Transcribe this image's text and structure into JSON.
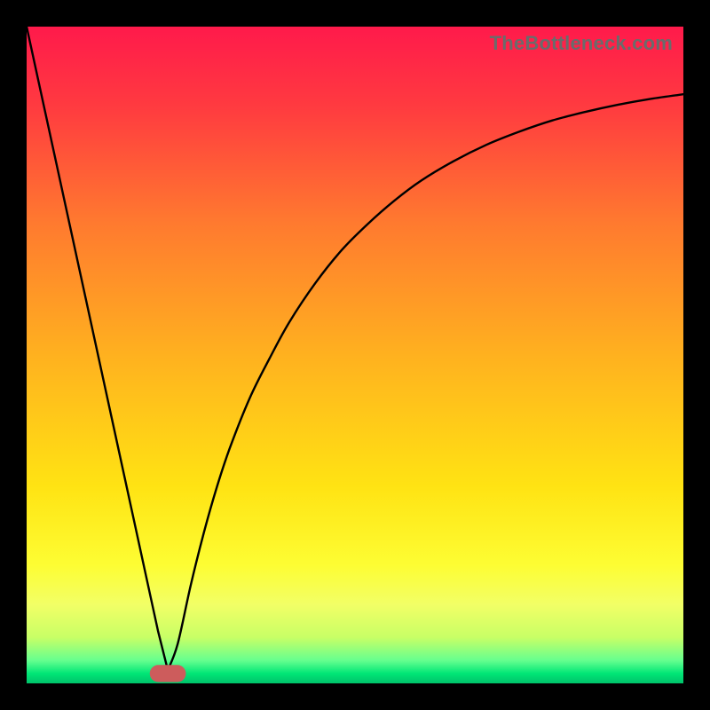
{
  "watermark": "TheBottleneck.com",
  "chart_data": {
    "type": "line",
    "title": "",
    "xlabel": "",
    "ylabel": "",
    "xlim": [
      0,
      100
    ],
    "ylim": [
      0,
      100
    ],
    "grid": false,
    "legend": false,
    "annotations": [],
    "background_gradient": {
      "stops": [
        {
          "offset": 0.0,
          "color": "#ff1a4b"
        },
        {
          "offset": 0.12,
          "color": "#ff3a40"
        },
        {
          "offset": 0.3,
          "color": "#ff7a2f"
        },
        {
          "offset": 0.5,
          "color": "#ffb11f"
        },
        {
          "offset": 0.7,
          "color": "#ffe313"
        },
        {
          "offset": 0.82,
          "color": "#fdfd33"
        },
        {
          "offset": 0.88,
          "color": "#f2ff66"
        },
        {
          "offset": 0.93,
          "color": "#c8ff66"
        },
        {
          "offset": 0.965,
          "color": "#66ff8f"
        },
        {
          "offset": 0.985,
          "color": "#00e676"
        },
        {
          "offset": 1.0,
          "color": "#00c26a"
        }
      ]
    },
    "marker": {
      "x": 21.5,
      "y": 1.5,
      "width": 5.5,
      "height": 2.6,
      "rx": 1.3,
      "color": "#cd5c5c"
    },
    "series": [
      {
        "name": "curve",
        "x": [
          0,
          2,
          4,
          6,
          8,
          10,
          12,
          14,
          16,
          18,
          20,
          21.5,
          23,
          25,
          27,
          29,
          31,
          34,
          37,
          40,
          44,
          48,
          52,
          56,
          60,
          65,
          70,
          75,
          80,
          85,
          90,
          95,
          100
        ],
        "y": [
          100,
          90.8,
          81.6,
          72.4,
          63.2,
          54.0,
          44.8,
          35.6,
          26.4,
          17.2,
          8.0,
          2.0,
          6.0,
          15.0,
          23.0,
          30.0,
          36.0,
          43.5,
          49.5,
          55.0,
          61.0,
          66.0,
          70.0,
          73.5,
          76.5,
          79.5,
          82.0,
          84.0,
          85.7,
          87.0,
          88.1,
          89.0,
          89.7
        ]
      }
    ]
  }
}
